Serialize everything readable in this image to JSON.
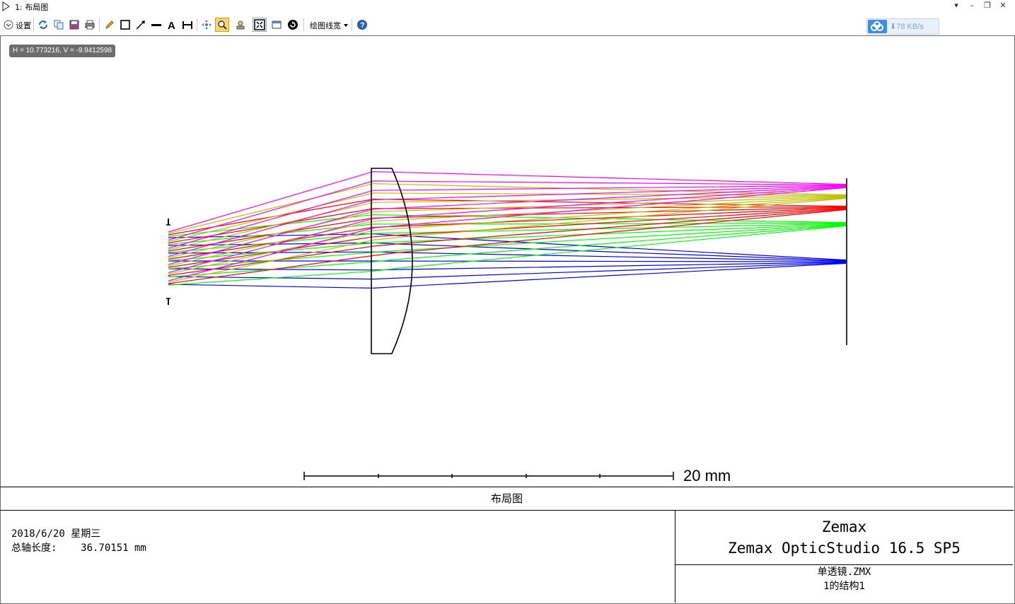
{
  "window": {
    "title": "1: 布局图",
    "controls": [
      "minimize",
      "restore",
      "close"
    ]
  },
  "toolbar": {
    "settings_label": "设置",
    "line_width_label": "绘图线宽",
    "items": [
      "refresh-icon",
      "copy-icon",
      "save-icon",
      "print-icon",
      "pencil-icon",
      "rectangle-icon",
      "arrow-icon",
      "line-icon",
      "text-icon",
      "dimension-icon",
      "pan-icon",
      "zoom-icon",
      "reset-zoom-icon",
      "fit-icon",
      "window-icon",
      "rotate-icon",
      "help-icon"
    ]
  },
  "net_speed": {
    "text": "⬇78 KB/s",
    "accent": "#3d8ee3"
  },
  "coords": {
    "text": "H = 10.773216, V = -9.9412598"
  },
  "plot": {
    "scale_label": "20 mm",
    "ray_colors": [
      "#0000ff",
      "#00ff00",
      "#ff0000",
      "#bfbf00",
      "#ff00ff"
    ],
    "ray_color_names": [
      "blue",
      "green",
      "red",
      "yellow",
      "magenta"
    ]
  },
  "caption": "布局图",
  "info": {
    "date_line": "2018/6/20 星期三",
    "axis_line": "总轴长度:    36.70151 mm",
    "company": "Zemax",
    "product": "Zemax OpticStudio 16.5 SP5",
    "file": "单透镜.ZMX",
    "config": "1的结构1"
  }
}
